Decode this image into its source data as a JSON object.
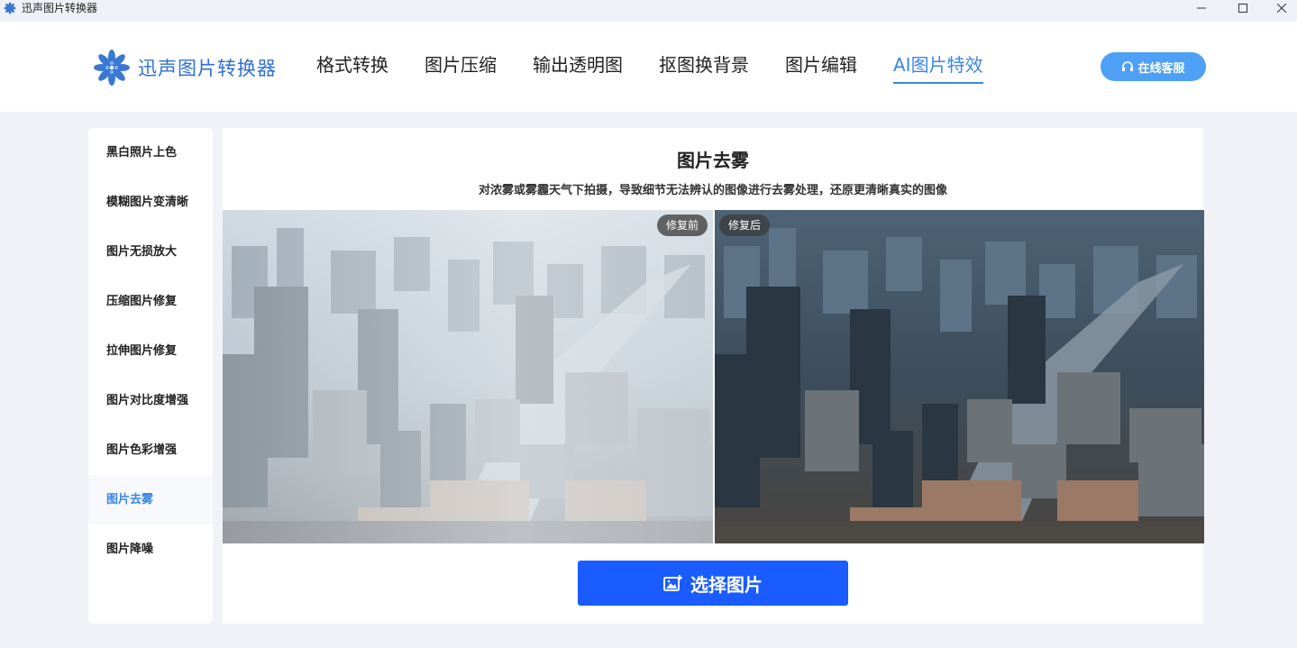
{
  "window": {
    "title": "迅声图片转换器",
    "icon": "snowflake-logo-icon"
  },
  "header": {
    "logo_text": "迅声图片转换器",
    "nav": [
      {
        "label": "格式转换",
        "active": false
      },
      {
        "label": "图片压缩",
        "active": false
      },
      {
        "label": "输出透明图",
        "active": false
      },
      {
        "label": "抠图换背景",
        "active": false
      },
      {
        "label": "图片编辑",
        "active": false
      },
      {
        "label": "AI图片特效",
        "active": true
      }
    ],
    "service_label": "在线客服",
    "service_icon": "headset-icon"
  },
  "sidebar": {
    "items": [
      {
        "label": "黑白照片上色",
        "active": false
      },
      {
        "label": "模糊图片变清晰",
        "active": false
      },
      {
        "label": "图片无损放大",
        "active": false
      },
      {
        "label": "压缩图片修复",
        "active": false
      },
      {
        "label": "拉伸图片修复",
        "active": false
      },
      {
        "label": "图片对比度增强",
        "active": false
      },
      {
        "label": "图片色彩增强",
        "active": false
      },
      {
        "label": "图片去雾",
        "active": true
      },
      {
        "label": "图片降噪",
        "active": false
      }
    ]
  },
  "main": {
    "title": "图片去雾",
    "subtitle": "对浓雾或雾霾天气下拍摄，导致细节无法辨认的图像进行去雾处理，还原更清晰真实的图像",
    "before_label": "修复前",
    "after_label": "修复后",
    "choose_label": "选择图片",
    "choose_icon": "add-image-icon"
  },
  "colors": {
    "accent": "#3a86e8",
    "primary_button": "#1a5cff",
    "service_button": "#4da0f5",
    "background": "#f0f2f7"
  }
}
